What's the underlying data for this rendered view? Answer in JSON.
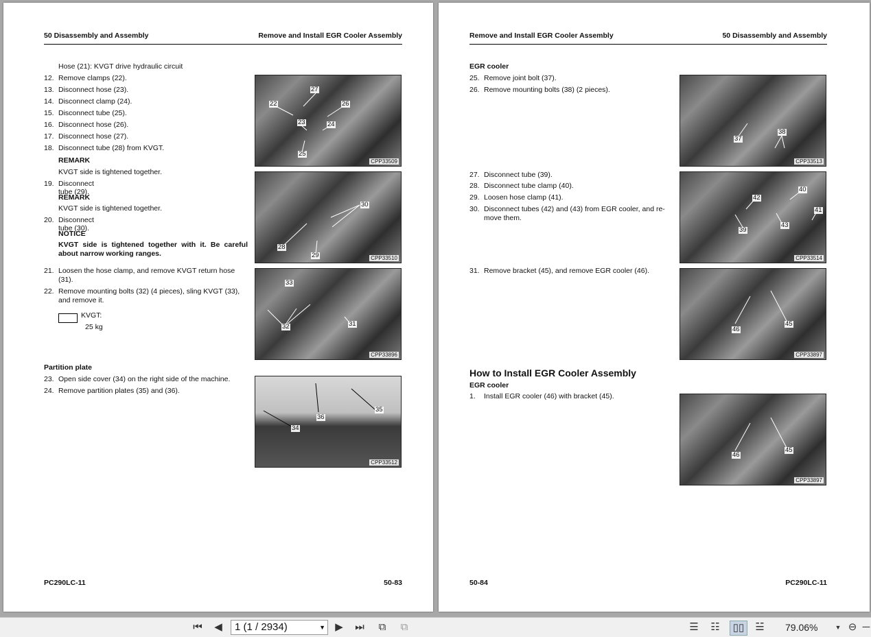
{
  "left_page": {
    "header_left": "50 Disassembly and Assembly",
    "header_right": "Remove and Install EGR Cooler Assembly",
    "intro": "Hose (21): KVGT drive hydraulic circuit",
    "steps_a": [
      {
        "n": "12.",
        "t": "Remove clamps (22)."
      },
      {
        "n": "13.",
        "t": "Disconnect hose (23)."
      },
      {
        "n": "14.",
        "t": "Disconnect clamp (24)."
      },
      {
        "n": "15.",
        "t": "Disconnect tube (25)."
      },
      {
        "n": "16.",
        "t": "Disconnect hose (26)."
      },
      {
        "n": "17.",
        "t": "Disconnect hose (27)."
      },
      {
        "n": "18.",
        "t": "Disconnect tube (28) from KVGT."
      }
    ],
    "remark1_title": "REMARK",
    "remark1_text": "KVGT side is tightened together.",
    "step19": {
      "n": "19.",
      "t": "Disconnect tube (29)."
    },
    "remark2_title": "REMARK",
    "remark2_text": "KVGT side is tightened together.",
    "step20": {
      "n": "20.",
      "t": "Disconnect tube (30)."
    },
    "notice_title": "NOTICE",
    "notice_line1": "KVGT side is tightened together with it. Be careful",
    "notice_line2": "about narrow working ranges.",
    "step21": {
      "n": "21.",
      "l1": "Loosen the hose clamp, and remove KVGT return hose",
      "l2": "(31)."
    },
    "step22": {
      "n": "22.",
      "l1": "Remove mounting bolts (32) (4 pieces), sling KVGT (33),",
      "l2": "and remove it."
    },
    "weight_label": "KVGT:",
    "weight_value": "25 kg",
    "partition_title": "Partition plate",
    "step23": {
      "n": "23.",
      "t": "Open side cover (34) on the right side of the machine."
    },
    "step24": {
      "n": "24.",
      "t": "Remove partition plates (35) and (36)."
    },
    "photos": [
      {
        "code": "CPP33509",
        "callouts": [
          "27",
          "22",
          "26",
          "23",
          "24",
          "25"
        ]
      },
      {
        "code": "CPP33510",
        "callouts": [
          "30",
          "28",
          "29"
        ]
      },
      {
        "code": "CPP33896",
        "callouts": [
          "33",
          "32",
          "31"
        ]
      },
      {
        "code": "CPP33512",
        "callouts": [
          "36",
          "35",
          "34"
        ]
      }
    ],
    "footer_left": "PC290LC-11",
    "footer_right": "50-83"
  },
  "right_page": {
    "header_left": "Remove and Install EGR Cooler Assembly",
    "header_right": "50 Disassembly and Assembly",
    "section1_title": "EGR cooler",
    "step25": {
      "n": "25.",
      "t": "Remove joint bolt (37)."
    },
    "step26": {
      "n": "26.",
      "t": "Remove mounting bolts (38) (2 pieces)."
    },
    "step27": {
      "n": "27.",
      "t": "Disconnect tube (39)."
    },
    "step28": {
      "n": "28.",
      "t": "Disconnect tube clamp (40)."
    },
    "step29": {
      "n": "29.",
      "t": "Loosen hose clamp (41)."
    },
    "step30": {
      "n": "30.",
      "l1": "Disconnect tubes (42) and (43) from EGR cooler, and re-",
      "l2": "move them."
    },
    "step31": {
      "n": "31.",
      "t": "Remove bracket (45), and remove EGR cooler (46)."
    },
    "install_title": "How to Install EGR Cooler Assembly",
    "section2_title": "EGR cooler",
    "step1": {
      "n": "1.",
      "t": "Install EGR cooler (46) with bracket (45)."
    },
    "photos": [
      {
        "code": "CPP33513",
        "callouts": [
          "37",
          "38"
        ]
      },
      {
        "code": "CPP33514",
        "callouts": [
          "40",
          "42",
          "41",
          "39",
          "43"
        ]
      },
      {
        "code": "CPP33897",
        "callouts": [
          "46",
          "45"
        ]
      },
      {
        "code": "CPP33897",
        "callouts": [
          "46",
          "45"
        ]
      }
    ],
    "footer_left": "50-84",
    "footer_right": "PC290LC-11"
  },
  "toolbar": {
    "page_field": "1 (1 / 2934)",
    "zoom": "79.06%",
    "icons": [
      "first-page-icon",
      "prev-page-icon",
      "next-page-icon",
      "last-page-icon",
      "rotate-icon",
      "fit-icon",
      "single-page-icon",
      "continuous-icon",
      "two-page-icon",
      "two-continuous-icon",
      "zoom-out-icon"
    ]
  }
}
